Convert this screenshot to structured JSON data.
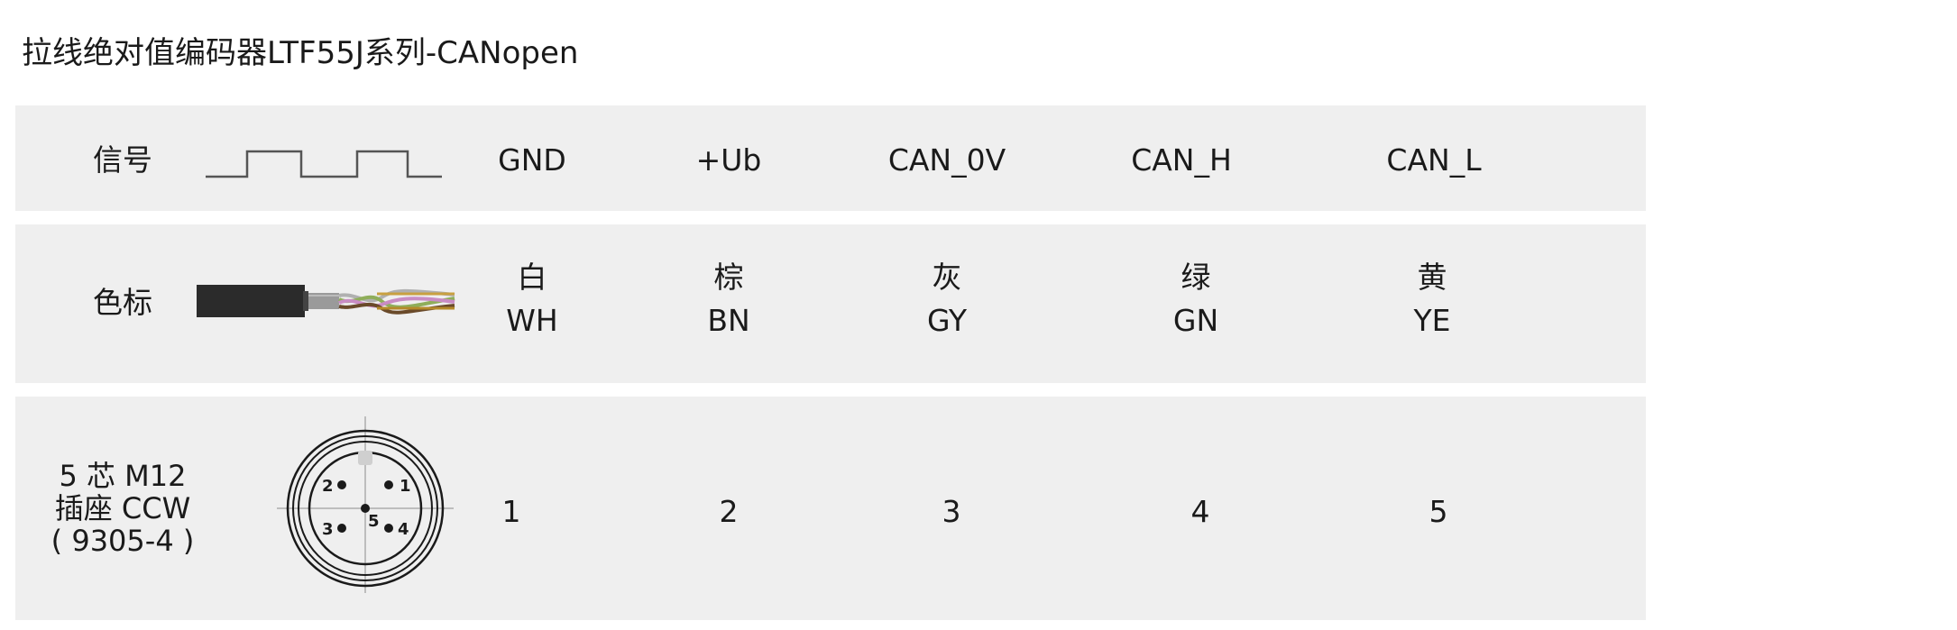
{
  "title": "拉线绝对值编码器LTF55J系列-CANopen",
  "rows": {
    "signal": {
      "label": "信号",
      "values": [
        "GND",
        "+Ub",
        "CAN_0V",
        "CAN_H",
        "CAN_L"
      ]
    },
    "color": {
      "label": "色标",
      "values": [
        {
          "cn": "白",
          "code": "WH"
        },
        {
          "cn": "棕",
          "code": "BN"
        },
        {
          "cn": "灰",
          "code": "GY"
        },
        {
          "cn": "绿",
          "code": "GN"
        },
        {
          "cn": "黄",
          "code": "YE"
        }
      ]
    },
    "connector": {
      "label_lines": [
        "5 芯 M12",
        "插座 CCW",
        "( 9305-4 )"
      ],
      "pins": [
        "1",
        "2",
        "3",
        "4",
        "5"
      ],
      "diagram_pin_labels": [
        "1",
        "2",
        "3",
        "4",
        "5"
      ]
    }
  },
  "colors": {
    "band": "#efefef",
    "cable_jacket": "#2a2a2a",
    "wire_colors": [
      "#b58a2a",
      "#8fae5a",
      "#b0b0b0",
      "#c98cc4",
      "#6a4a2a"
    ]
  }
}
